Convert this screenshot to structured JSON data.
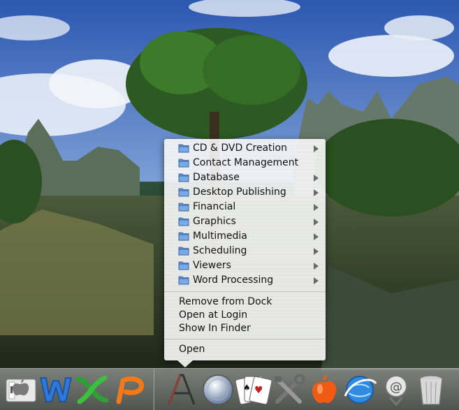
{
  "menu": {
    "folder_items": [
      {
        "label": "CD & DVD Creation",
        "has_submenu": true
      },
      {
        "label": "Contact Management",
        "has_submenu": false
      },
      {
        "label": "Database",
        "has_submenu": true
      },
      {
        "label": "Desktop Publishing",
        "has_submenu": true
      },
      {
        "label": "Financial",
        "has_submenu": true
      },
      {
        "label": "Graphics",
        "has_submenu": true
      },
      {
        "label": "Multimedia",
        "has_submenu": true
      },
      {
        "label": "Scheduling",
        "has_submenu": true
      },
      {
        "label": "Viewers",
        "has_submenu": true
      },
      {
        "label": "Word Processing",
        "has_submenu": true
      }
    ],
    "actions": {
      "remove_from_dock": "Remove from Dock",
      "open_at_login": "Open at Login",
      "show_in_finder": "Show In Finder",
      "open": "Open"
    }
  },
  "dock": {
    "left_icons": [
      "finder-icon",
      "word-icon",
      "excel-icon",
      "powerpoint-icon"
    ],
    "right_icons": [
      "applications-folder-icon",
      "sherlock-icon",
      "solitaire-icon",
      "system-preferences-icon",
      "apple-icon",
      "internet-explorer-icon",
      "mail-icon",
      "trash-icon"
    ]
  },
  "colors": {
    "folder": "#5f93d6",
    "menu_text": "#111111"
  }
}
